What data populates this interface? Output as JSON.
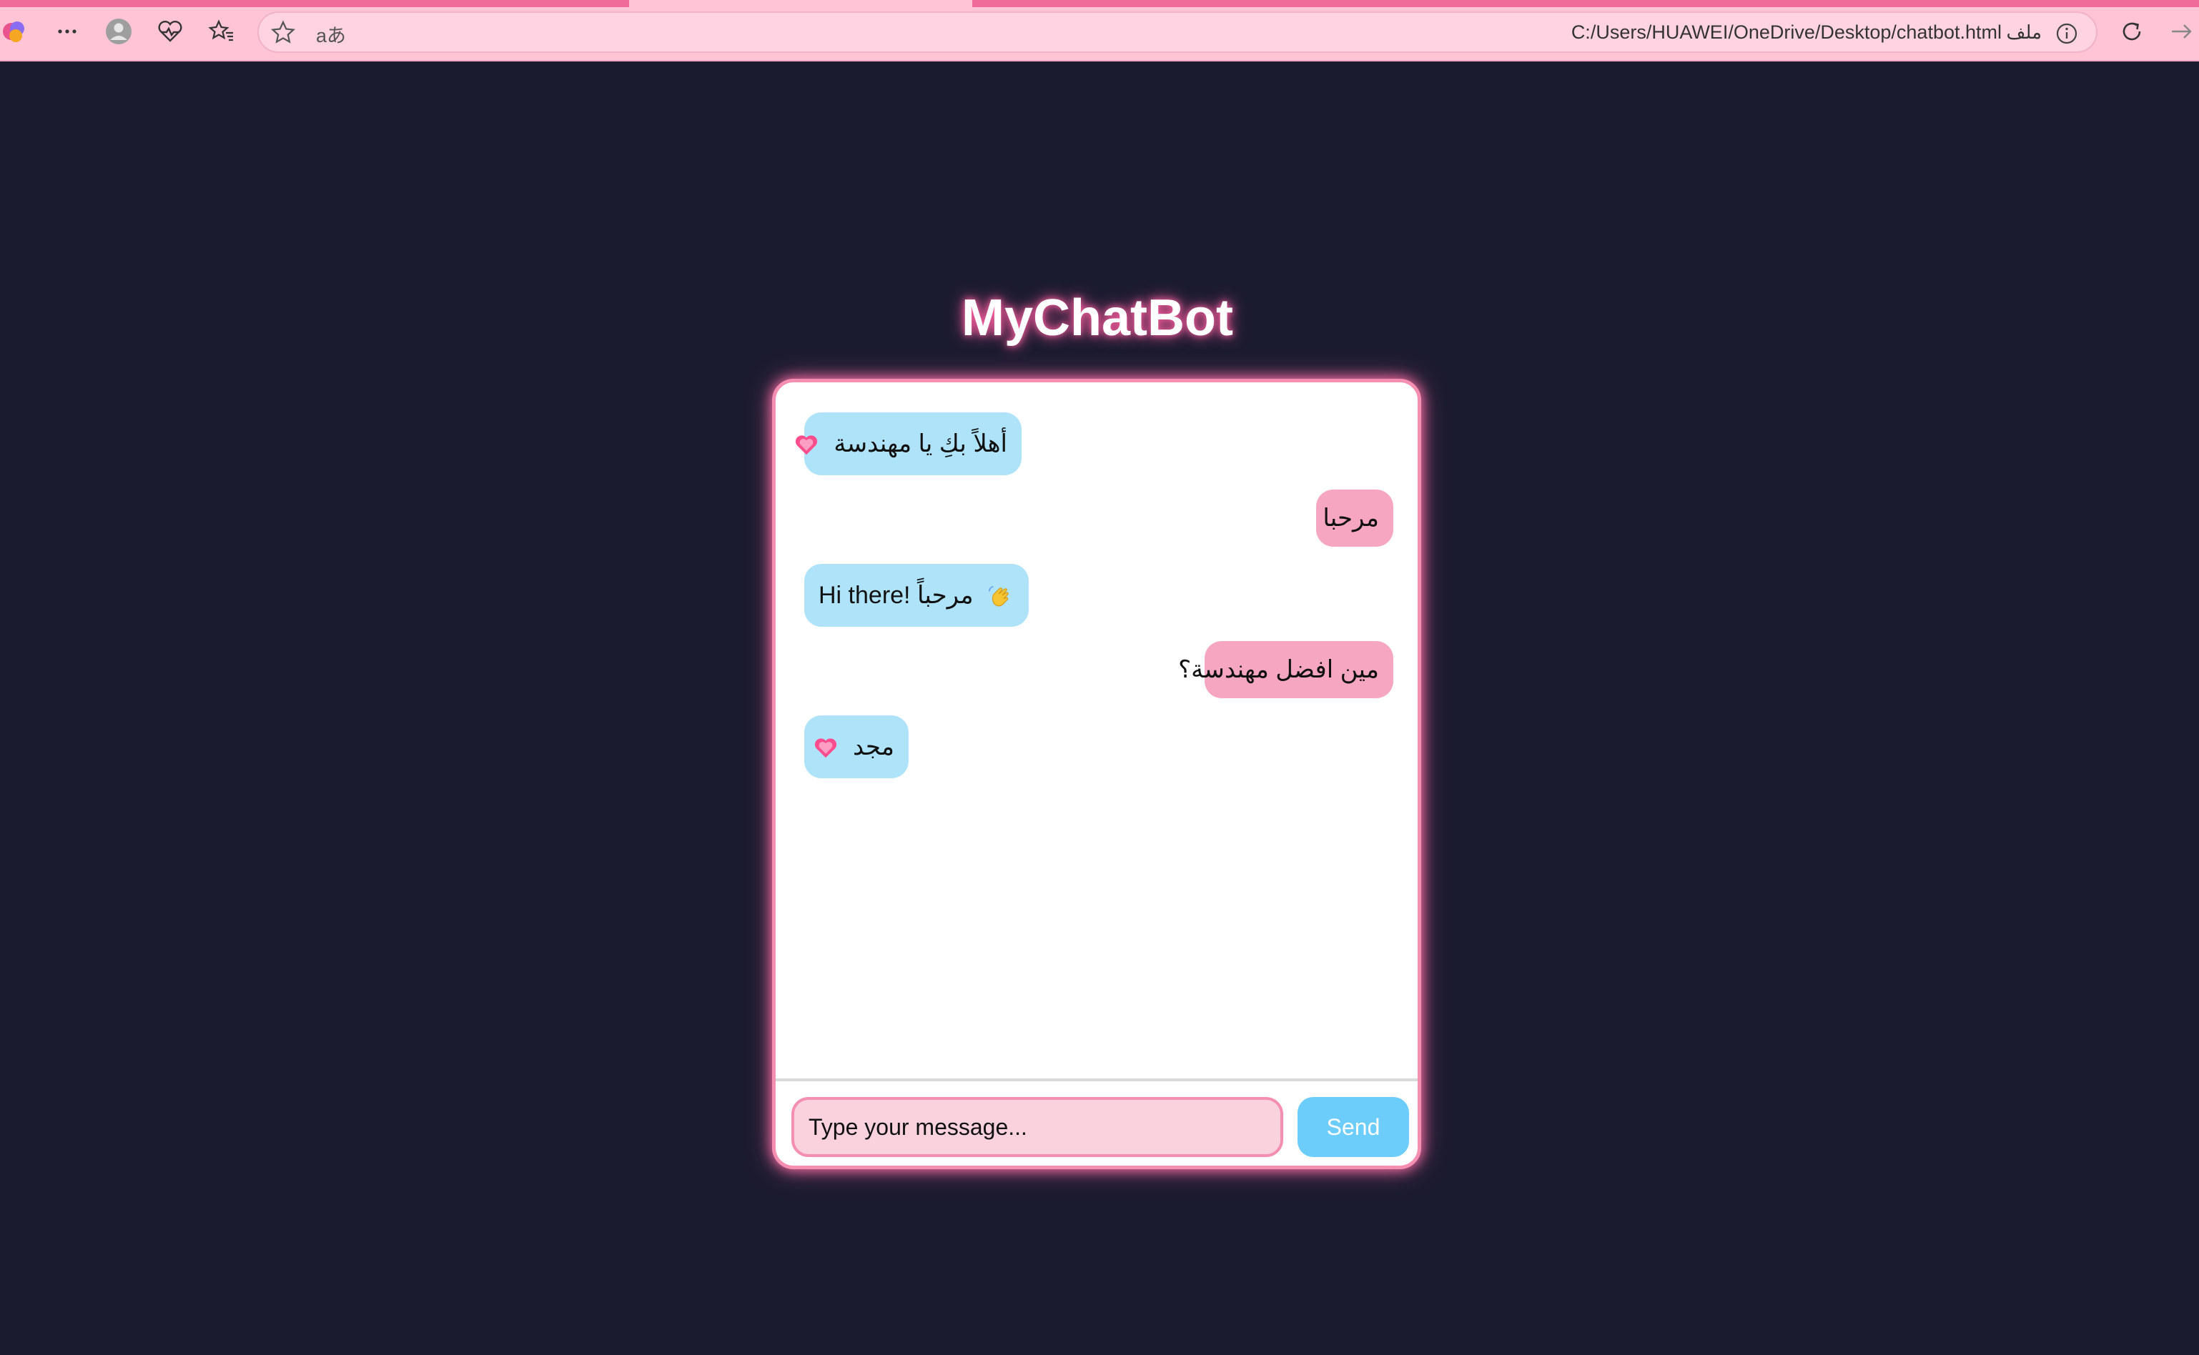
{
  "browser": {
    "address_url": "C:/Users/HUAWEI/OneDrive/Desktop/chatbot.html",
    "site_label": "ملف",
    "translate_glyph": "aあ",
    "icons": [
      "copilot-icon",
      "more-icon",
      "profile-icon",
      "health-icon",
      "favorites-icon",
      "star-icon",
      "translate-icon",
      "info-icon",
      "refresh-icon",
      "forward-icon"
    ]
  },
  "page": {
    "title": "MyChatBot"
  },
  "chat": {
    "messages": [
      {
        "from": "bot",
        "text": "أهلاً بكِ يا مهندسة",
        "emoji": "heart-icon"
      },
      {
        "from": "user",
        "text": "مرحبا"
      },
      {
        "from": "bot",
        "text": "Hi there! مرحباً",
        "emoji": "waving-hand-icon"
      },
      {
        "from": "user",
        "text": "مين افضل مهندسة؟"
      },
      {
        "from": "bot",
        "text": "مجد",
        "emoji": "heart-icon"
      }
    ],
    "input_placeholder": "Type your message...",
    "send_label": "Send"
  },
  "colors": {
    "background": "#1b1b2f",
    "chrome": "#ffc4d6",
    "bot_bubble": "#aee3fa",
    "user_bubble": "#f7a6c2",
    "accent_pink": "#f48fb1",
    "send_button": "#6ccdfb"
  }
}
